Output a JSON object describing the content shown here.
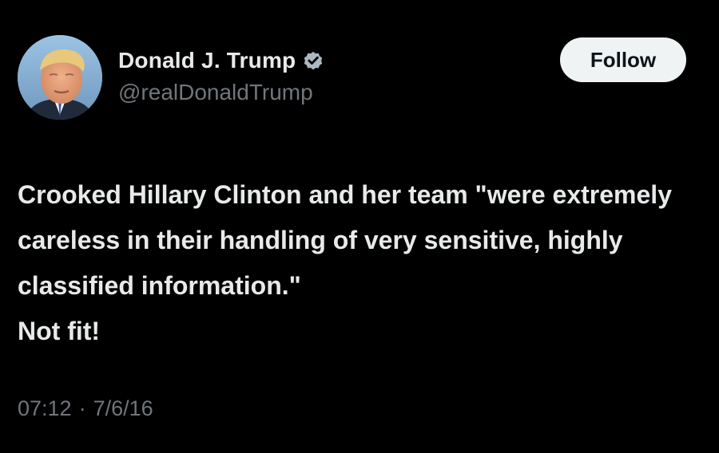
{
  "author": {
    "display_name": "Donald J. Trump",
    "handle": "@realDonaldTrump",
    "verified": true,
    "verified_color": "#aab8c2",
    "avatar_icon": "profile-photo"
  },
  "actions": {
    "follow_label": "Follow"
  },
  "tweet": {
    "text": "Crooked Hillary Clinton and her team \"were extremely careless in their handling of very sensitive, highly classified information.\"\nNot fit!",
    "time": "07:12",
    "separator": "·",
    "date": "7/6/16"
  },
  "colors": {
    "background": "#000000",
    "primary_text": "#e7e9ea",
    "secondary_text": "#71767b",
    "button_bg": "#eff3f4",
    "button_text": "#0f1419"
  }
}
